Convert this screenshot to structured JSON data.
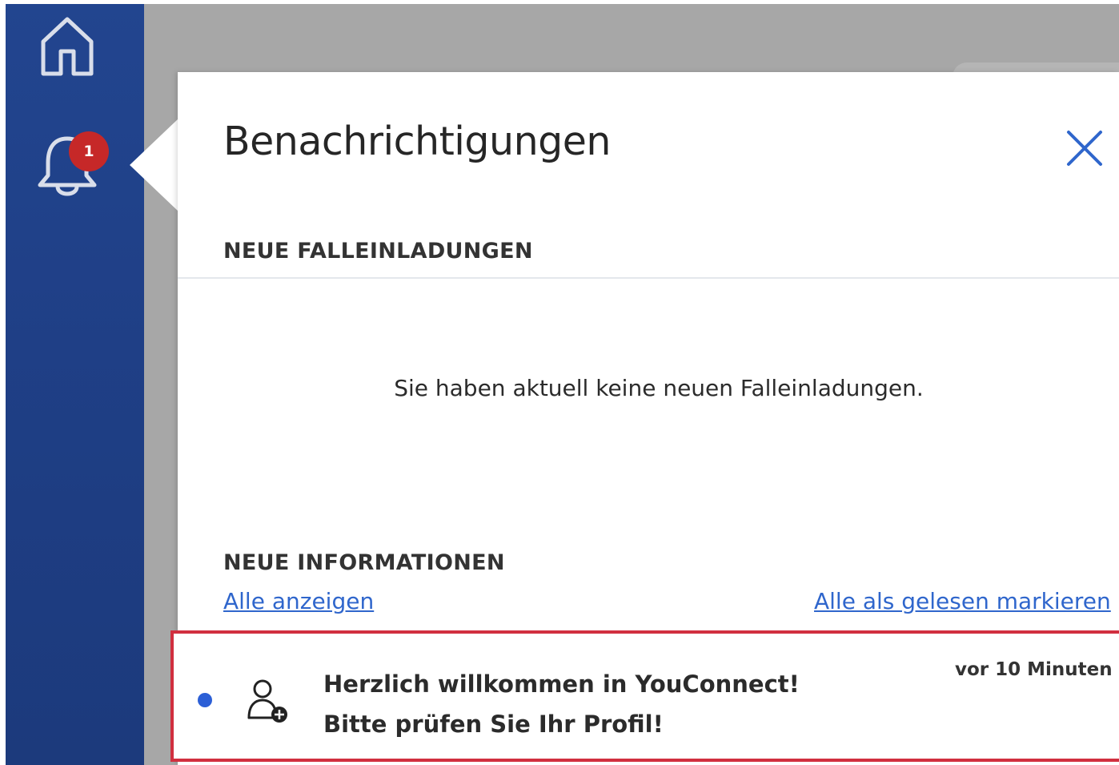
{
  "sidebar": {
    "home_icon": "home-icon",
    "bell_icon": "bell-icon",
    "notification_badge": "1",
    "badge_color": "#c62828",
    "background_color": "#22458f"
  },
  "panel": {
    "title": "Benachrichtigungen",
    "close_icon": "close-icon",
    "accent_color": "#2f66cc",
    "invites": {
      "heading": "NEUE FALLEINLADUNGEN",
      "empty_message": "Sie haben aktuell keine neuen Falleinladungen."
    },
    "information": {
      "heading": "NEUE INFORMATIONEN",
      "show_all_label": "Alle anzeigen",
      "mark_all_read_label": "Alle als gelesen markieren",
      "items": [
        {
          "icon": "add-user-icon",
          "unread": true,
          "text": "Herzlich willkommen in YouConnect! Bitte prüfen Sie Ihr Profil!",
          "time": "vor 10 Minuten",
          "highlight_color": "#d12f3f"
        }
      ]
    }
  }
}
